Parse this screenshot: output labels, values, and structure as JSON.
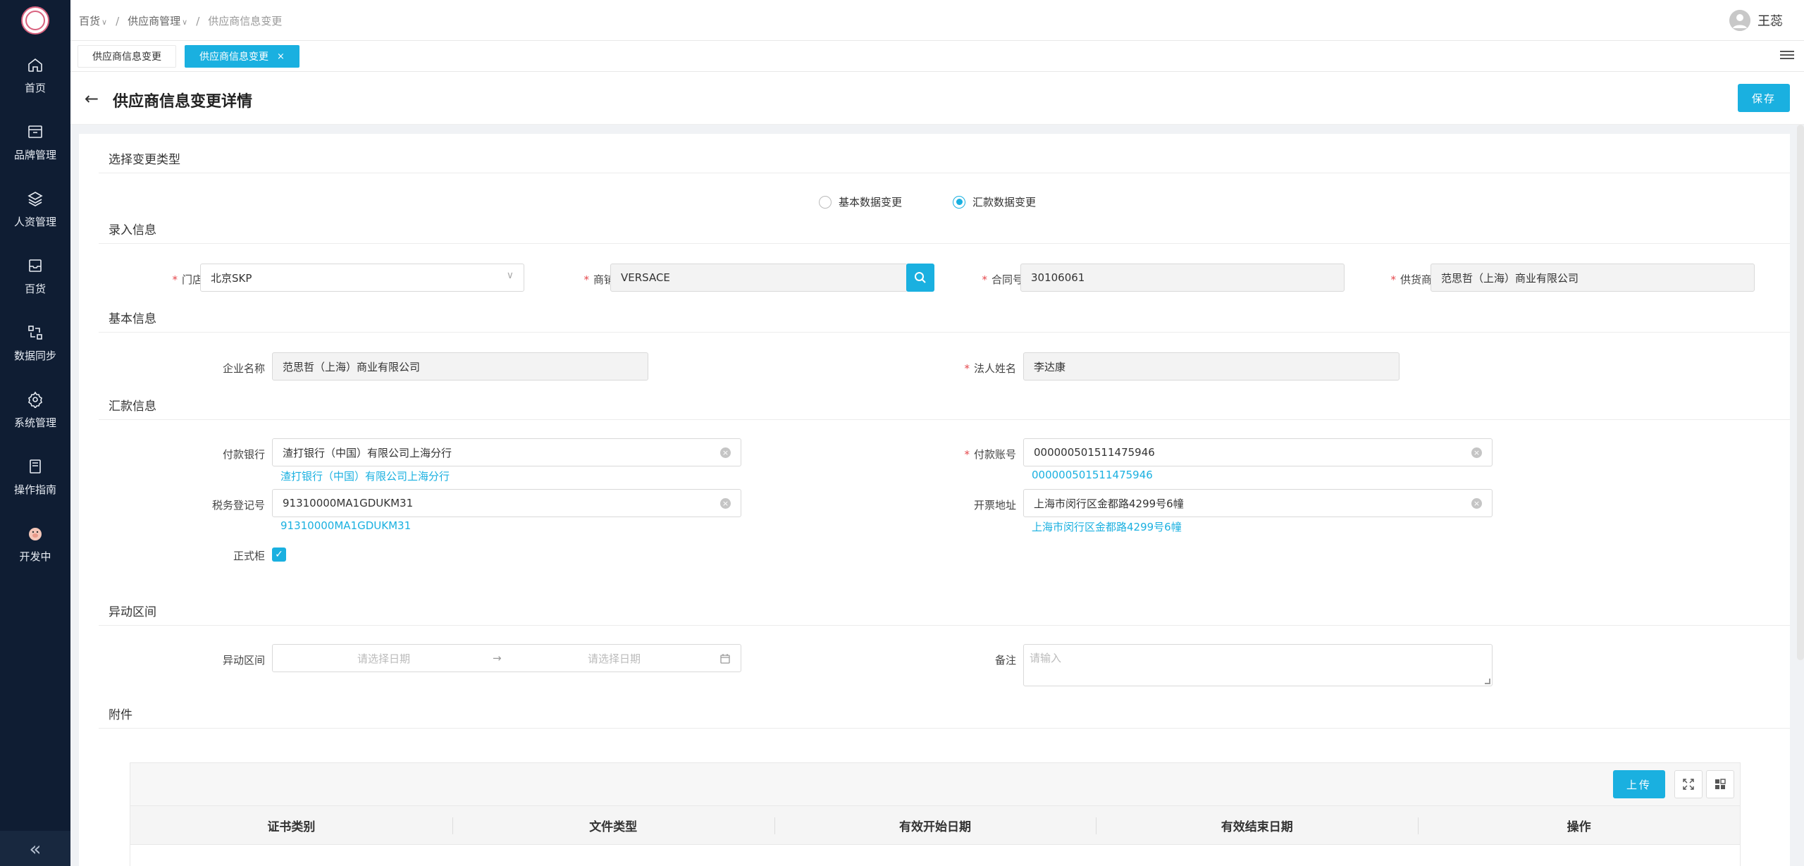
{
  "nav": {
    "items": [
      {
        "label": "首页",
        "icon": "home-icon"
      },
      {
        "label": "品牌管理",
        "icon": "box-icon"
      },
      {
        "label": "人资管理",
        "icon": "layers-icon"
      },
      {
        "label": "百货",
        "icon": "inbox-icon"
      },
      {
        "label": "数据同步",
        "icon": "sync-icon"
      },
      {
        "label": "系统管理",
        "icon": "gear-icon"
      },
      {
        "label": "操作指南",
        "icon": "book-icon"
      },
      {
        "label": "开发中",
        "icon": "pig-icon"
      }
    ],
    "collapse": "«"
  },
  "breadcrumb": {
    "level1": "百货",
    "level2": "供应商管理",
    "level3": "供应商信息变更",
    "sep": "/"
  },
  "user": {
    "name": "王蕊"
  },
  "tabs": [
    {
      "label": "供应商信息变更"
    },
    {
      "label": "供应商信息变更",
      "close": "×"
    }
  ],
  "page": {
    "title": "供应商信息变更详情",
    "save_label": "保存"
  },
  "change_type": {
    "title": "选择变更类型",
    "options": [
      "基本数据变更",
      "汇款数据变更"
    ],
    "selected": "汇款数据变更"
  },
  "entry": {
    "title": "录入信息",
    "store_label": "门店",
    "store_value": "北京SKP",
    "shop_label": "商铺",
    "shop_value": "VERSACE",
    "contract_label": "合同号",
    "contract_value": "30106061",
    "supplier_label": "供货商",
    "supplier_value": "范思哲（上海）商业有限公司"
  },
  "basic": {
    "title": "基本信息",
    "company_label": "企业名称",
    "company_value": "范思哲（上海）商业有限公司",
    "legal_label": "法人姓名",
    "legal_value": "李达康"
  },
  "remit": {
    "title": "汇款信息",
    "bank_label": "付款银行",
    "bank_value": "渣打银行（中国）有限公司上海分行",
    "bank_hint": "渣打银行（中国）有限公司上海分行",
    "account_label": "付款账号",
    "account_value": "000000501511475946",
    "account_hint": "000000501511475946",
    "tax_label": "税务登记号",
    "tax_value": "91310000MA1GDUKM31",
    "tax_hint": "91310000MA1GDUKM31",
    "invoice_addr_label": "开票地址",
    "invoice_addr_value": "上海市闵行区金都路4299号6幢",
    "invoice_addr_hint": "上海市闵行区金都路4299号6幢",
    "counter_label": "正式柜",
    "counter_checked": true
  },
  "anomaly": {
    "title": "异动区间",
    "range_label": "异动区间",
    "start_placeholder": "请选择日期",
    "end_placeholder": "请选择日期",
    "arrow": "→",
    "remark_label": "备注",
    "remark_placeholder": "请输入"
  },
  "attachment": {
    "title": "附件",
    "upload_label": "上传",
    "columns": [
      "证书类别",
      "文件类型",
      "有效开始日期",
      "有效结束日期",
      "操作"
    ]
  },
  "colors": {
    "accent": "#1ab0e0",
    "sidebar": "#0f1d33",
    "required": "#e5484d"
  }
}
